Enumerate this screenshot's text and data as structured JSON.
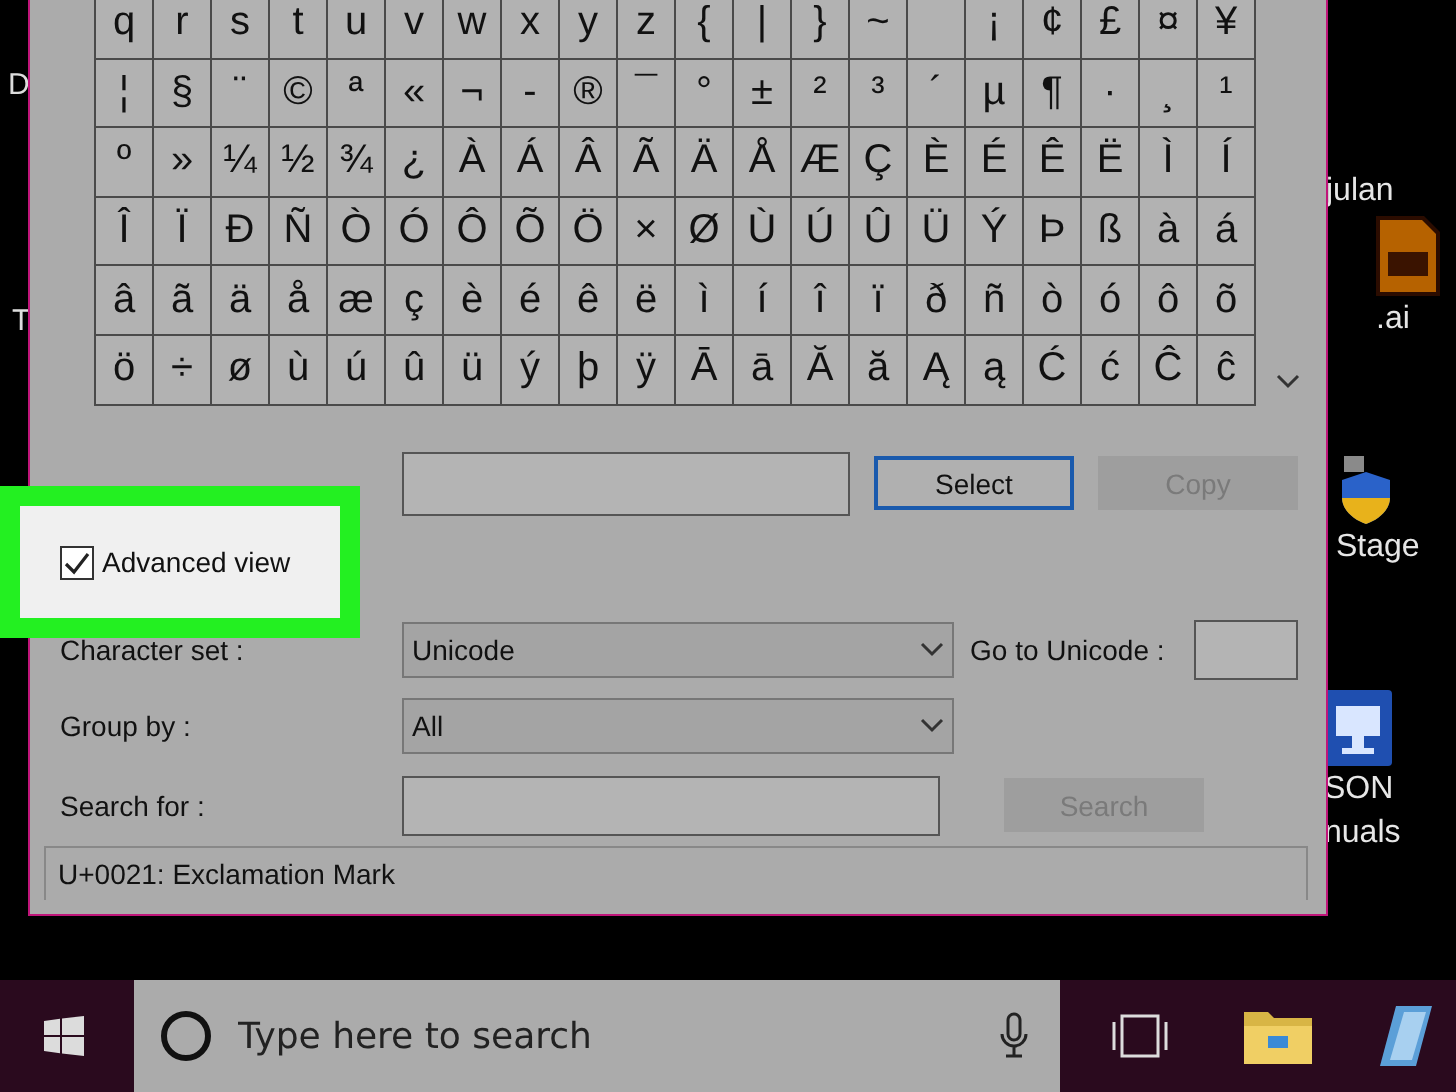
{
  "desktop": {
    "edge_labels": [
      "D",
      "T"
    ],
    "icons": [
      {
        "kind": "none",
        "labels": [
          "julan"
        ]
      },
      {
        "kind": "ai",
        "labels": [
          ".ai"
        ]
      },
      {
        "kind": "shield",
        "labels": [
          "Stage"
        ]
      },
      {
        "kind": "computer",
        "labels": [
          "SON",
          "nuals"
        ]
      }
    ]
  },
  "character_map": {
    "grid": [
      [
        "q",
        "r",
        "s",
        "t",
        "u",
        "v",
        "w",
        "x",
        "y",
        "z",
        "{",
        "|",
        "}",
        "~",
        {
          "kind": "blank"
        },
        "¡",
        "¢",
        "£",
        "¤",
        "¥"
      ],
      [
        "¦",
        "§",
        "¨",
        "©",
        "ª",
        "«",
        "¬",
        "-",
        "®",
        "¯",
        "°",
        "±",
        "²",
        "³",
        "´",
        "µ",
        "¶",
        "·",
        "¸",
        "¹"
      ],
      [
        "º",
        "»",
        "¼",
        "½",
        "¾",
        "¿",
        "À",
        "Á",
        "Â",
        "Ã",
        "Ä",
        "Å",
        "Æ",
        "Ç",
        "È",
        "É",
        "Ê",
        "Ë",
        "Ì",
        "Í"
      ],
      [
        "Î",
        "Ï",
        "Ð",
        "Ñ",
        "Ò",
        "Ó",
        "Ô",
        "Õ",
        "Ö",
        "×",
        "Ø",
        "Ù",
        "Ú",
        "Û",
        "Ü",
        "Ý",
        "Þ",
        "ß",
        "à",
        "á"
      ],
      [
        "â",
        "ã",
        "ä",
        "å",
        "æ",
        "ç",
        "è",
        "é",
        "ê",
        "ë",
        "ì",
        "í",
        "î",
        "ï",
        "ð",
        "ñ",
        "ò",
        "ó",
        "ô",
        "õ"
      ],
      [
        "ö",
        "÷",
        "ø",
        "ù",
        "ú",
        "û",
        "ü",
        "ý",
        "þ",
        "ÿ",
        "Ā",
        "ā",
        "Ă",
        "ă",
        "Ą",
        "ą",
        "Ć",
        "ć",
        "Ĉ",
        "ĉ"
      ]
    ],
    "select_button": {
      "label": "Select",
      "disabled": false
    },
    "copy_button": {
      "label": "Copy",
      "disabled": true
    },
    "advanced_view": {
      "label": "Advanced view",
      "checked": true
    },
    "character_set": {
      "label": "Character set :",
      "value": "Unicode"
    },
    "go_to_unicode": {
      "label": "Go to Unicode :"
    },
    "group_by": {
      "label": "Group by :",
      "value": "All"
    },
    "search_for": {
      "label": "Search for :"
    },
    "search_button": {
      "label": "Search",
      "disabled": true
    },
    "status": "U+0021: Exclamation Mark"
  },
  "taskbar": {
    "search": {
      "placeholder": "Type here to search"
    }
  }
}
